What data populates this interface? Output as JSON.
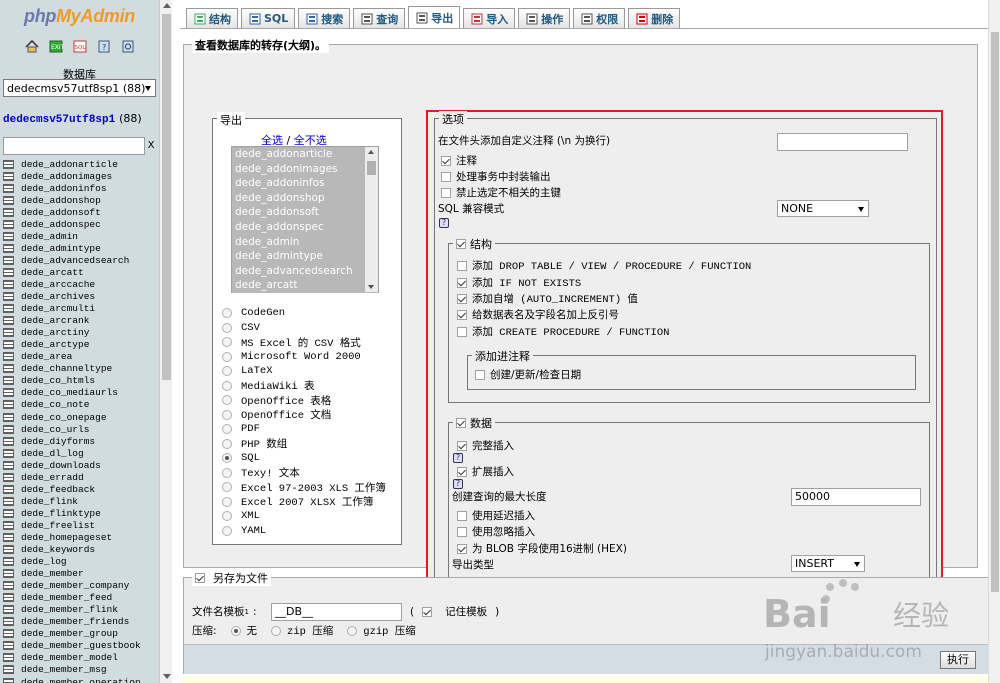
{
  "sidebar": {
    "logo_a": "php",
    "logo_b": "MyAdmin",
    "nav_icons": [
      "home-icon",
      "exit-icon",
      "sql-icon",
      "docs-icon",
      "reload-icon"
    ],
    "db_label": "数据库",
    "db_select": "dedecmsv57utf8sp1 (88)",
    "db_name": "dedecmsv57utf8sp1",
    "db_count": "(88)",
    "filter_clear": "X",
    "tables": [
      "dede_addonarticle",
      "dede_addonimages",
      "dede_addoninfos",
      "dede_addonshop",
      "dede_addonsoft",
      "dede_addonspec",
      "dede_admin",
      "dede_admintype",
      "dede_advancedsearch",
      "dede_arcatt",
      "dede_arccache",
      "dede_archives",
      "dede_arcmulti",
      "dede_arcrank",
      "dede_arctiny",
      "dede_arctype",
      "dede_area",
      "dede_channeltype",
      "dede_co_htmls",
      "dede_co_mediaurls",
      "dede_co_note",
      "dede_co_onepage",
      "dede_co_urls",
      "dede_diyforms",
      "dede_dl_log",
      "dede_downloads",
      "dede_erradd",
      "dede_feedback",
      "dede_flink",
      "dede_flinktype",
      "dede_freelist",
      "dede_homepageset",
      "dede_keywords",
      "dede_log",
      "dede_member",
      "dede_member_company",
      "dede_member_feed",
      "dede_member_flink",
      "dede_member_friends",
      "dede_member_group",
      "dede_member_guestbook",
      "dede_member_model",
      "dede_member_msg",
      "dede_member_operation"
    ]
  },
  "tabs": [
    {
      "label": "结构",
      "icon": "structure-icon",
      "color": "#4a6"
    },
    {
      "label": "SQL",
      "icon": "sql-icon",
      "color": "#36a"
    },
    {
      "label": "搜索",
      "icon": "search-icon",
      "color": "#36a"
    },
    {
      "label": "查询",
      "icon": "query-icon",
      "color": "#555"
    },
    {
      "label": "导出",
      "icon": "export-icon",
      "color": "#555",
      "active": true
    },
    {
      "label": "导入",
      "icon": "import-icon",
      "color": "#c33"
    },
    {
      "label": "操作",
      "icon": "operations-icon",
      "color": "#555"
    },
    {
      "label": "权限",
      "icon": "privileges-icon",
      "color": "#555"
    },
    {
      "label": "删除",
      "icon": "drop-icon",
      "color": "#c00"
    }
  ],
  "dump": {
    "legend": "查看数据库的转存(大纲)。",
    "export": {
      "legend": "导出",
      "select_all": "全选",
      "sep": " / ",
      "unselect_all": "全不选",
      "tables": [
        "dede_addonarticle",
        "dede_addonimages",
        "dede_addoninfos",
        "dede_addonshop",
        "dede_addonsoft",
        "dede_addonspec",
        "dede_admin",
        "dede_admintype",
        "dede_advancedsearch",
        "dede_arcatt"
      ],
      "formats": [
        "CodeGen",
        "CSV",
        "MS Excel 的 CSV 格式",
        "Microsoft Word 2000",
        "LaTeX",
        "MediaWiki 表",
        "OpenOffice 表格",
        "OpenOffice 文档",
        "PDF",
        "PHP 数组",
        "SQL",
        "Texy! 文本",
        "Excel 97-2003 XLS 工作簿",
        "Excel 2007 XLSX 工作簿",
        "XML",
        "YAML"
      ],
      "selected_format": "SQL"
    },
    "options": {
      "legend": "选项",
      "header_comment_label": "在文件头添加自定义注释 (\\n 为换行)",
      "header_comment_value": "",
      "comments": "注释",
      "use_transaction": "处理事务中封装输出",
      "disable_fk": "禁止选定不相关的主键",
      "compat_label": "SQL 兼容模式",
      "compat_value": "NONE",
      "help": "?",
      "structure": {
        "legend": "结构",
        "drop": "添加 DROP TABLE / VIEW / PROCEDURE / FUNCTION",
        "if_not_exists": "添加 IF NOT EXISTS",
        "auto_increment": "添加自增 (AUTO_INCREMENT) 值",
        "backquotes": "给数据表名及字段名加上反引号",
        "procedure": "添加 CREATE PROCEDURE / FUNCTION",
        "comments_legend": "添加进注释",
        "dates": "创建/更新/检查日期"
      },
      "data": {
        "legend": "数据",
        "complete_insert": "完整插入",
        "extended_insert": "扩展插入",
        "max_query_label": "创建查询的最大长度",
        "max_query_value": "50000",
        "delayed": "使用延迟插入",
        "ignore": "使用忽略插入",
        "hex": "为 BLOB 字段使用16进制 (HEX)",
        "export_type_label": "导出类型",
        "export_type_value": "INSERT"
      }
    }
  },
  "save": {
    "legend": "另存为文件",
    "template_label": "文件名模板",
    "sup": "1",
    "colon": ":",
    "template_value": "__DB__",
    "paren_open": "(",
    "remember": "记住模板",
    "paren_close": ")",
    "compress_label": "压缩:",
    "none": "无",
    "zip": "zip 压缩",
    "gzip": "gzip 压缩",
    "execute": "执行"
  },
  "watermark": {
    "brand": "Bai",
    "brand2": "经验",
    "url": "jingyan.baidu.com"
  }
}
